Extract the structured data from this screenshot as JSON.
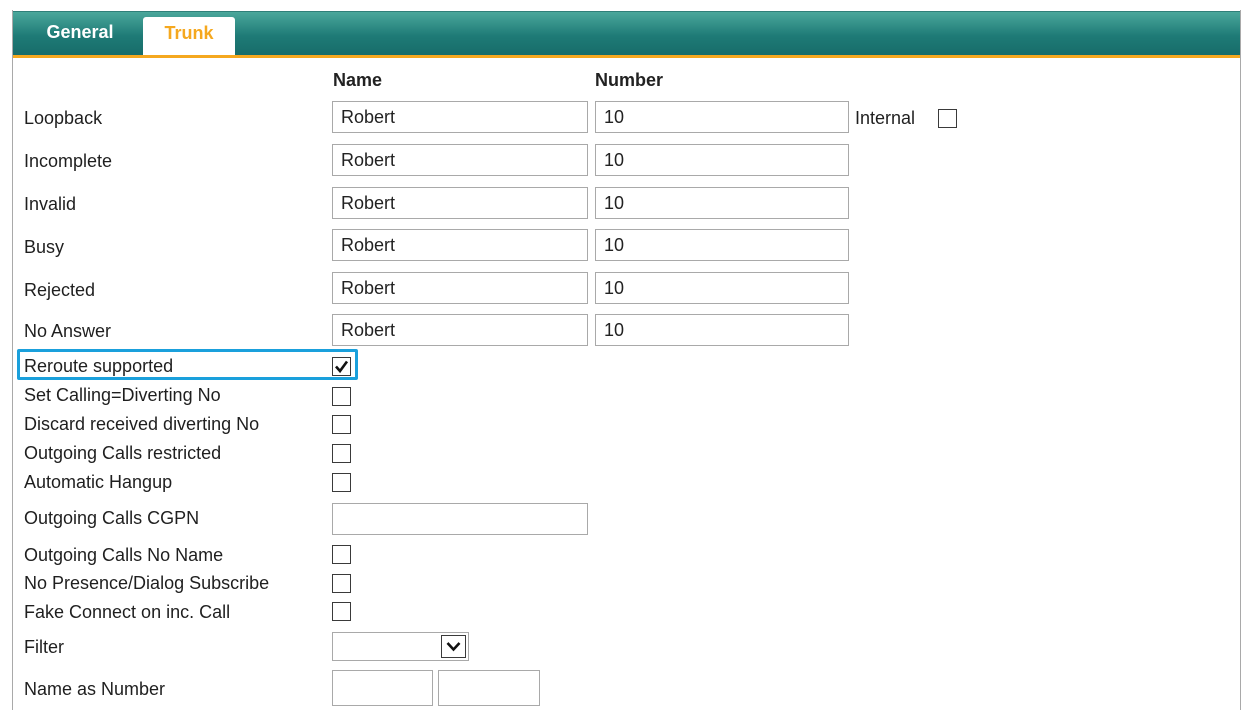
{
  "tabs": [
    {
      "label": "General",
      "active": false
    },
    {
      "label": "Trunk",
      "active": true
    }
  ],
  "columns": {
    "name": "Name",
    "number": "Number"
  },
  "rows": [
    {
      "label": "Loopback",
      "name": "Robert",
      "number": "10"
    },
    {
      "label": "Incomplete",
      "name": "Robert",
      "number": "10"
    },
    {
      "label": "Invalid",
      "name": "Robert",
      "number": "10"
    },
    {
      "label": "Busy",
      "name": "Robert",
      "number": "10"
    },
    {
      "label": "Rejected",
      "name": "Robert",
      "number": "10"
    },
    {
      "label": "No Answer",
      "name": "Robert",
      "number": "10"
    }
  ],
  "internal": {
    "label": "Internal",
    "checked": false
  },
  "options": [
    {
      "label": "Reroute supported",
      "checked": true
    },
    {
      "label": "Set Calling=Diverting No",
      "checked": false
    },
    {
      "label": "Discard received diverting No",
      "checked": false
    },
    {
      "label": "Outgoing Calls restricted",
      "checked": false
    },
    {
      "label": "Automatic Hangup",
      "checked": false
    }
  ],
  "cgpn": {
    "label": "Outgoing Calls CGPN",
    "value": ""
  },
  "options2": [
    {
      "label": "Outgoing Calls No Name",
      "checked": false
    },
    {
      "label": "No Presence/Dialog Subscribe",
      "checked": false
    },
    {
      "label": "Fake Connect on inc. Call",
      "checked": false
    }
  ],
  "filter": {
    "label": "Filter",
    "selected": ""
  },
  "name_as_number": {
    "label": "Name as Number",
    "value1": "",
    "value2": ""
  },
  "colors": {
    "teal": "#1e7a76",
    "accent": "#f5a81f",
    "highlight": "#1aa0dc"
  }
}
